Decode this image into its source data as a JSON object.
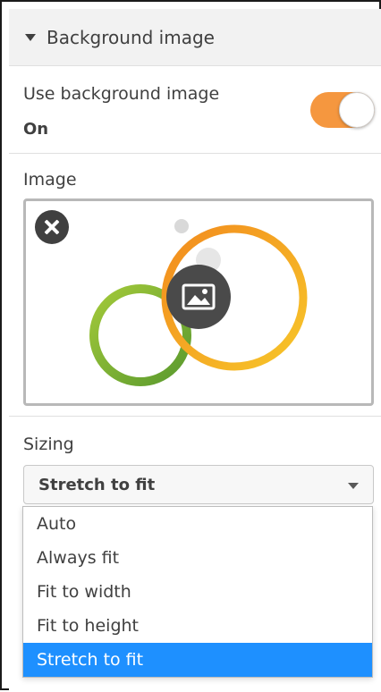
{
  "header": {
    "title": "Background image",
    "icon": "caret-down-icon"
  },
  "use_background": {
    "label": "Use background image",
    "value": "On",
    "toggle_on": true,
    "toggle_color": "#f5973f"
  },
  "image": {
    "label": "Image",
    "remove_icon": "close-icon",
    "placeholder_icon": "image-icon"
  },
  "sizing": {
    "label": "Sizing",
    "selected": "Stretch to fit",
    "options": [
      {
        "label": "Auto",
        "selected": false
      },
      {
        "label": "Always fit",
        "selected": false
      },
      {
        "label": "Fit to width",
        "selected": false
      },
      {
        "label": "Fit to height",
        "selected": false
      },
      {
        "label": "Stretch to fit",
        "selected": true
      }
    ],
    "highlight_color": "#1e90ff"
  }
}
